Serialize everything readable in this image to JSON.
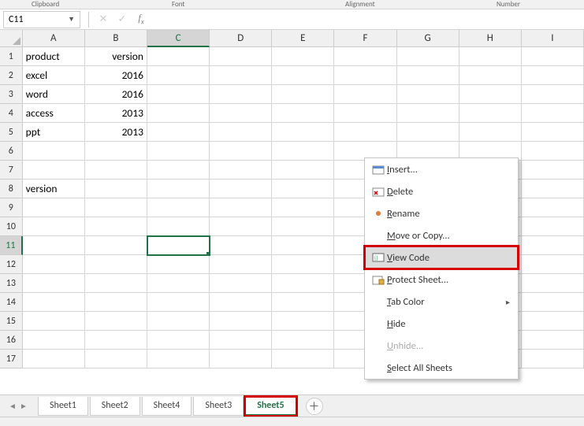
{
  "ribbon_groups": {
    "clipboard": "Clipboard",
    "font": "Font",
    "alignment": "Alignment",
    "number": "Number"
  },
  "name_box": "C11",
  "formula_value": "",
  "columns": [
    "A",
    "B",
    "C",
    "D",
    "E",
    "F",
    "G",
    "H",
    "I"
  ],
  "active_col": "C",
  "active_row": 11,
  "row_count": 17,
  "cells": {
    "A1": "product",
    "B1": "version",
    "A2": "excel",
    "B2": "2016",
    "A3": "word",
    "B3": "2016",
    "A4": "access",
    "B4": "2013",
    "A5": "ppt",
    "B5": "2013",
    "A8": "version"
  },
  "numeric_cols": [
    "B"
  ],
  "sheet_tabs": [
    "Sheet1",
    "Sheet2",
    "Sheet4",
    "Sheet3",
    "Sheet5"
  ],
  "active_tab": "Sheet5",
  "highlighted_tab": "Sheet5",
  "context_menu": [
    {
      "label": "Insert...",
      "icon": "insert",
      "key": "I"
    },
    {
      "label": "Delete",
      "icon": "delete",
      "key": "D"
    },
    {
      "label": "Rename",
      "icon": "dot",
      "key": "R"
    },
    {
      "label": "Move or Copy...",
      "icon": "",
      "key": "M"
    },
    {
      "label": "View Code",
      "icon": "code",
      "key": "V",
      "highlight": true
    },
    {
      "label": "Protect Sheet...",
      "icon": "protect",
      "key": "P"
    },
    {
      "label": "Tab Color",
      "icon": "",
      "key": "T",
      "submenu": true
    },
    {
      "label": "Hide",
      "icon": "",
      "key": "H"
    },
    {
      "label": "Unhide...",
      "icon": "",
      "key": "U",
      "disabled": true
    },
    {
      "label": "Select All Sheets",
      "icon": "",
      "key": "S"
    }
  ]
}
